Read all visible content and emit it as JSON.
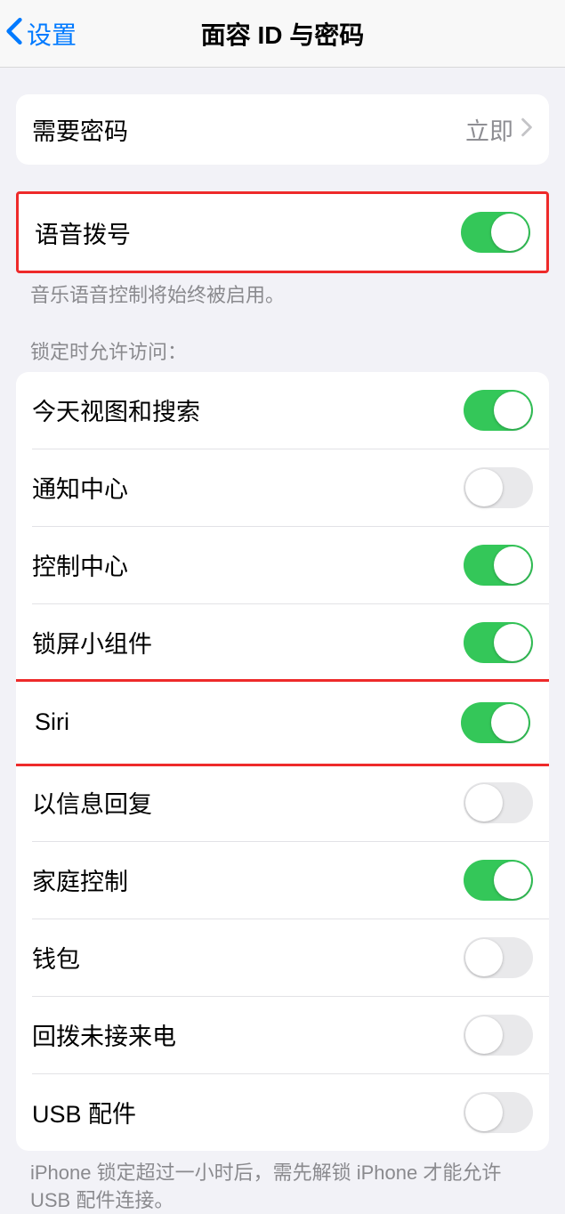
{
  "nav": {
    "back_label": "设置",
    "title": "面容 ID 与密码"
  },
  "require_passcode": {
    "label": "需要密码",
    "value": "立即"
  },
  "voice_dial": {
    "label": "语音拨号",
    "on": true,
    "footer": "音乐语音控制将始终被启用。"
  },
  "lock_access": {
    "header": "锁定时允许访问：",
    "items": [
      {
        "label": "今天视图和搜索",
        "on": true
      },
      {
        "label": "通知中心",
        "on": false
      },
      {
        "label": "控制中心",
        "on": true
      },
      {
        "label": "锁屏小组件",
        "on": true
      },
      {
        "label": "Siri",
        "on": true,
        "highlight": true
      },
      {
        "label": "以信息回复",
        "on": false
      },
      {
        "label": "家庭控制",
        "on": true
      },
      {
        "label": "钱包",
        "on": false
      },
      {
        "label": "回拨未接来电",
        "on": false
      },
      {
        "label": "USB 配件",
        "on": false
      }
    ],
    "footer": "iPhone 锁定超过一小时后，需先解锁 iPhone 才能允许 USB 配件连接。"
  }
}
